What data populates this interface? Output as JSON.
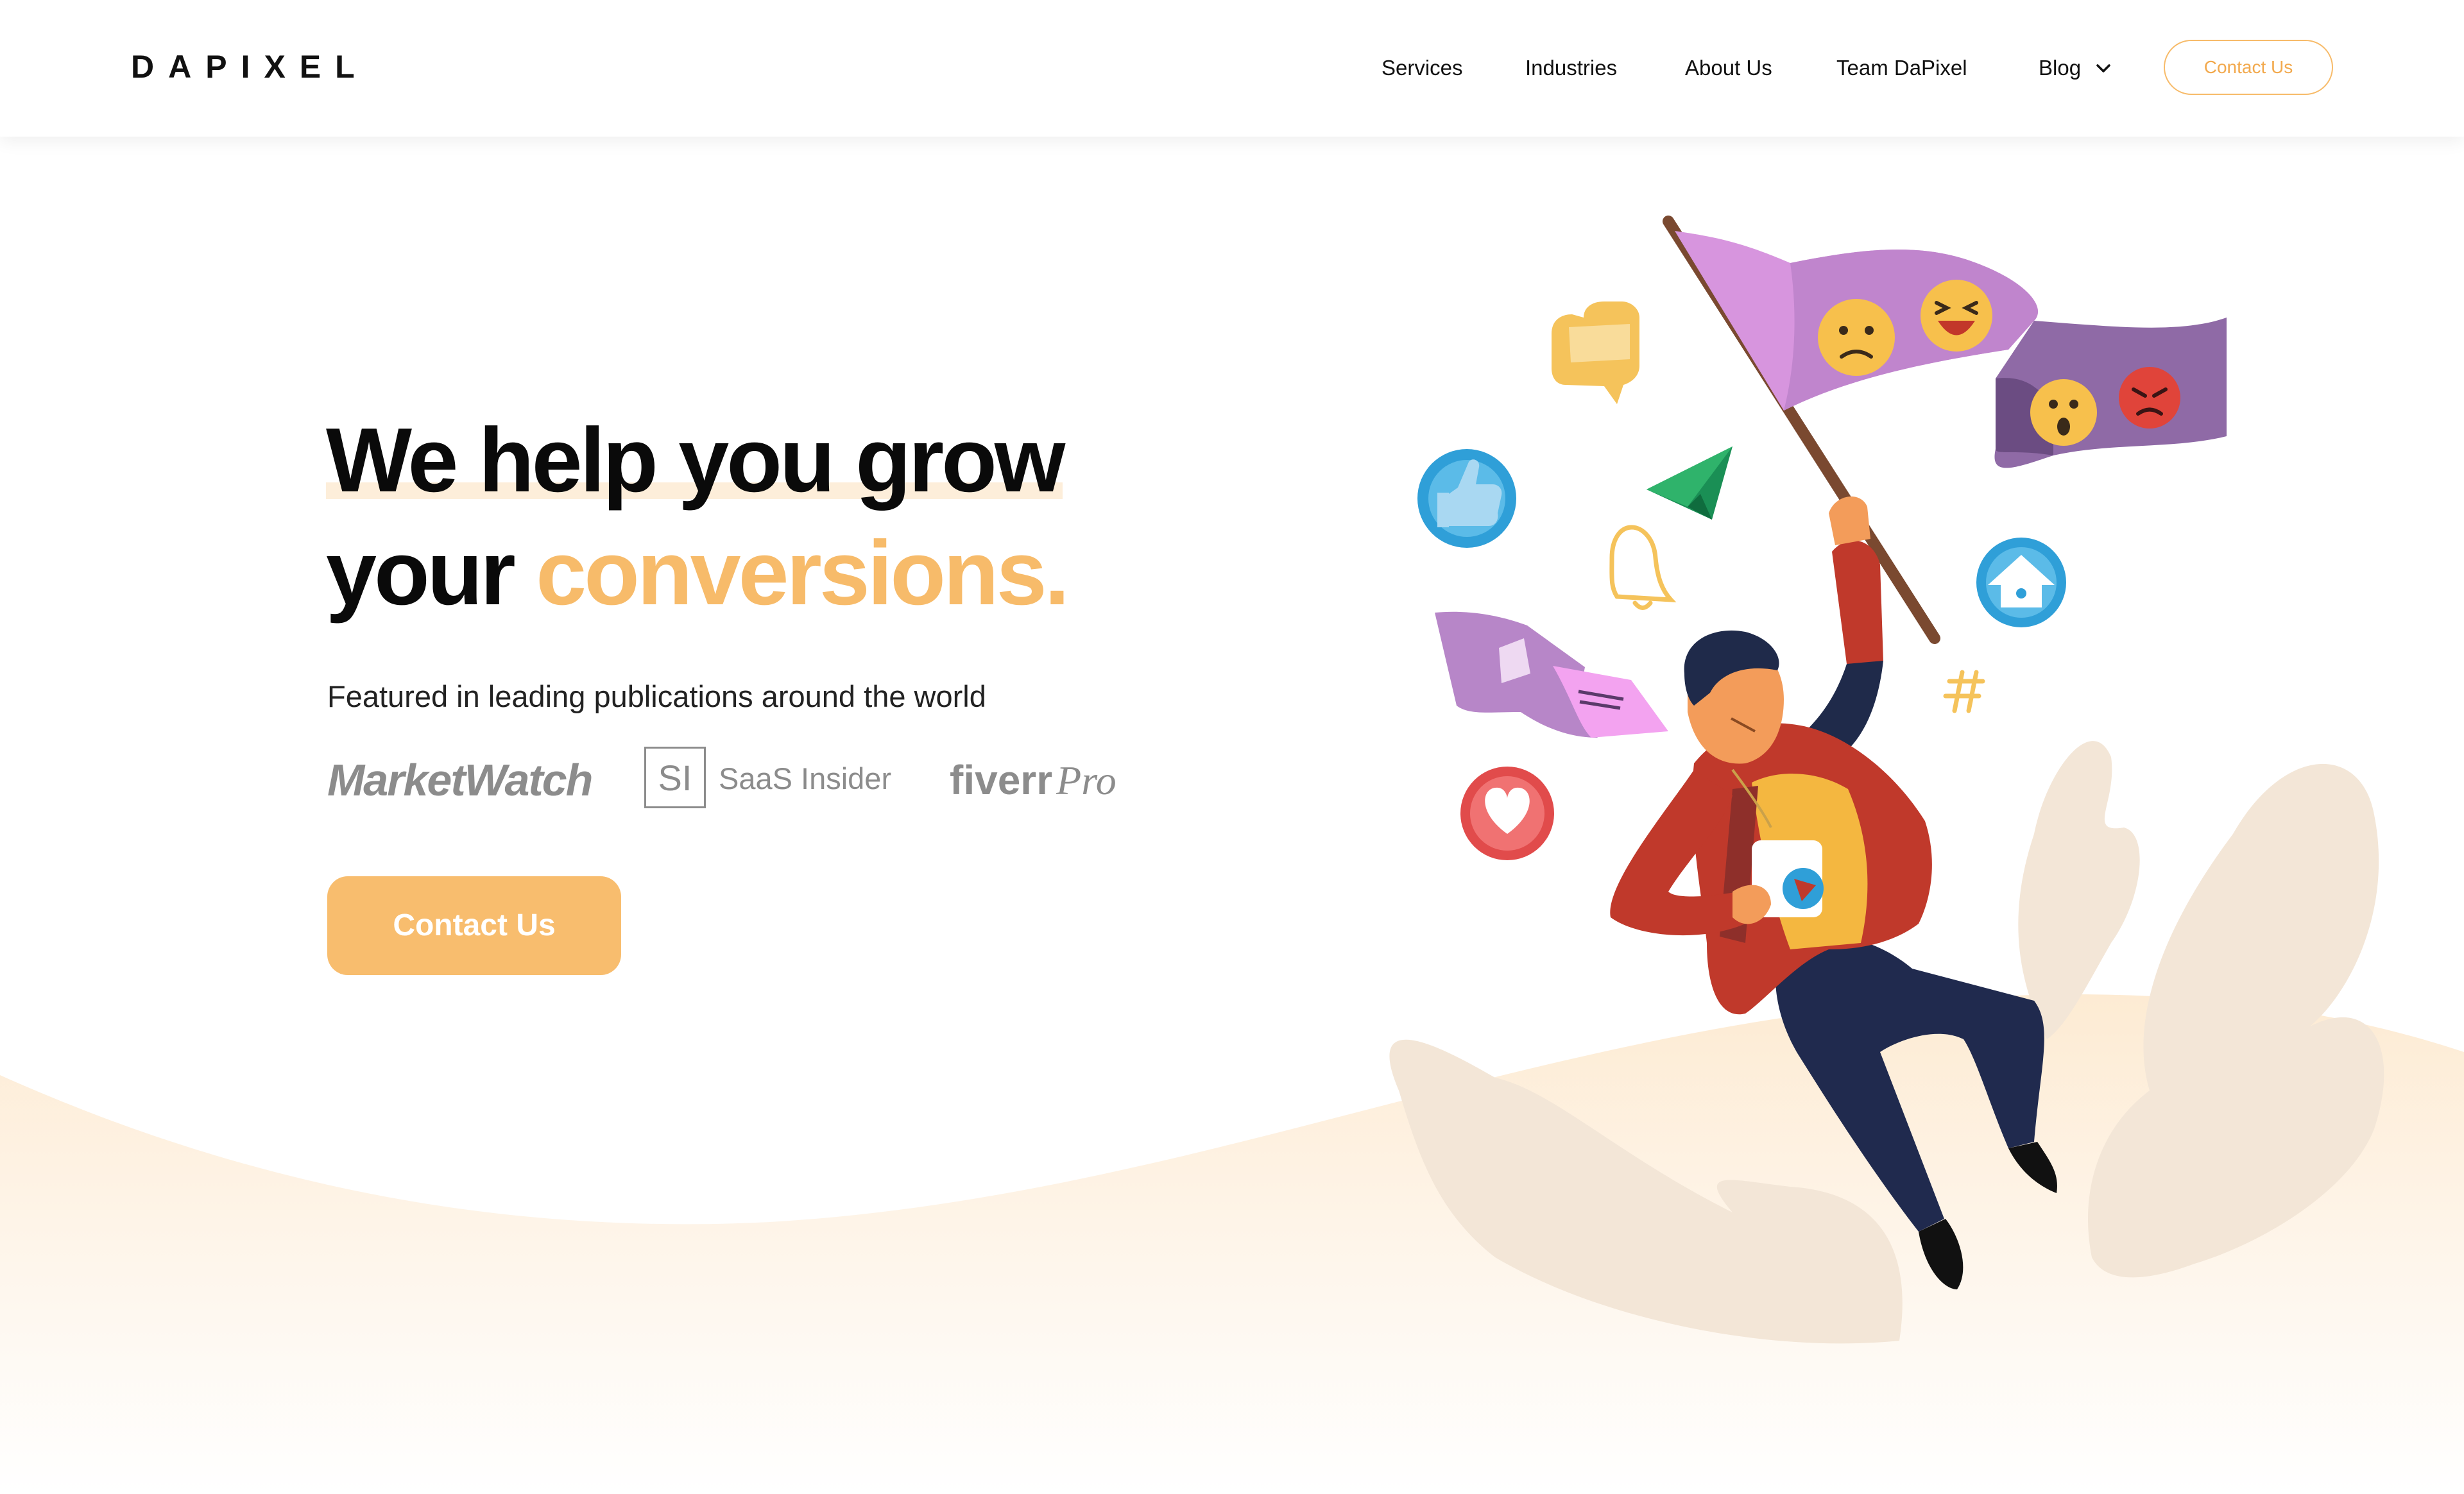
{
  "header": {
    "logo": "DAPIXEL",
    "nav": [
      {
        "label": "Services"
      },
      {
        "label": "Industries"
      },
      {
        "label": "About Us"
      },
      {
        "label": "Team DaPixel"
      },
      {
        "label": "Blog",
        "has_dropdown": true
      }
    ],
    "cta_label": "Contact Us"
  },
  "hero": {
    "headline_line1": "We help you grow",
    "headline_line2_start": "your",
    "headline_line2_accent": "conversions.",
    "featured_text": "Featured in leading publications around the world",
    "press_logos": {
      "marketwatch": "MarketWatch",
      "saas_insider_mark": "SI",
      "saas_insider_name": "SaaS Insider",
      "fiverr": "fiverr",
      "fiverr_pro": "Pro"
    },
    "cta_label": "Contact Us"
  },
  "colors": {
    "accent": "#f7bb6a",
    "accent_button": "#f8bd6e",
    "text_dark": "#0a0a0a",
    "logo_gray": "#8c8c8c",
    "wave": "#fdf0e0"
  },
  "illustration": {
    "icons": [
      "flag-icon",
      "emoji-sad-icon",
      "emoji-laugh-icon",
      "emoji-wow-icon",
      "emoji-angry-icon",
      "chat-bubble-icon",
      "thumbs-up-icon",
      "paper-plane-icon",
      "bell-icon",
      "home-icon",
      "hashtag-icon",
      "heart-icon",
      "image-flag-icon",
      "man-with-flag"
    ]
  }
}
